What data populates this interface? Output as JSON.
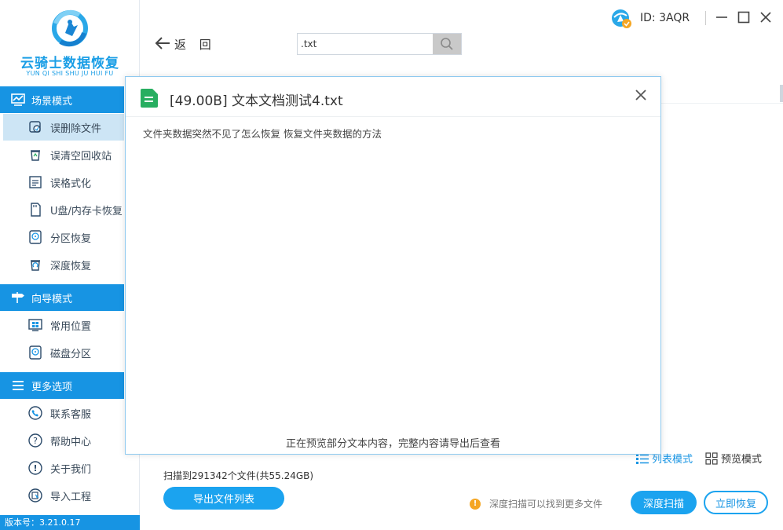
{
  "app": {
    "logo_name": "云骑士数据恢复",
    "logo_sub": "YUN QI SHI SHU JU HUI FU",
    "version": "版本号：3.21.0.17"
  },
  "sidebar": {
    "scene_mode": {
      "title": "场景模式",
      "items": [
        {
          "label": "误删除文件",
          "icon": "recycle-file-icon"
        },
        {
          "label": "误清空回收站",
          "icon": "recycle-bin-icon"
        },
        {
          "label": "误格式化",
          "icon": "format-disk-icon"
        },
        {
          "label": "U盘/内存卡恢复",
          "icon": "sd-card-icon"
        },
        {
          "label": "分区恢复",
          "icon": "partition-icon"
        },
        {
          "label": "深度恢复",
          "icon": "deep-recover-icon"
        }
      ]
    },
    "guide_mode": {
      "title": "向导模式",
      "items": [
        {
          "label": "常用位置",
          "icon": "windows-icon"
        },
        {
          "label": "磁盘分区",
          "icon": "disk-icon"
        }
      ]
    },
    "more_options": {
      "title": "更多选项",
      "items": [
        {
          "label": "联系客服",
          "icon": "phone-icon"
        },
        {
          "label": "帮助中心",
          "icon": "help-icon"
        },
        {
          "label": "关于我们",
          "icon": "info-icon"
        },
        {
          "label": "导入工程",
          "icon": "import-icon"
        }
      ]
    }
  },
  "toolbar": {
    "back_label": "返 回",
    "search_value": ".txt"
  },
  "user": {
    "id_label": "ID: 3AQR"
  },
  "modal": {
    "title": "[49.00B] 文本文档测试4.txt",
    "content": "文件夹数据突然不见了怎么恢复  恢复文件夹数据的方法",
    "footer": "正在预览部分文本内容，完整内容请导出后查看"
  },
  "bottom": {
    "view_list": "列表模式",
    "view_preview": "预览模式",
    "scan_info": "扫描到291342个文件(共55.24GB)",
    "export_button": "导出文件列表",
    "tip": "深度扫描可以找到更多文件",
    "deep_scan_button": "深度扫描",
    "recover_button": "立即恢复"
  },
  "colors": {
    "accent": "#1794e3",
    "button": "#1ba3ef",
    "active_item": "#cde5f5",
    "tip_dot": "#f5a623",
    "file_icon": "#27ae60"
  }
}
